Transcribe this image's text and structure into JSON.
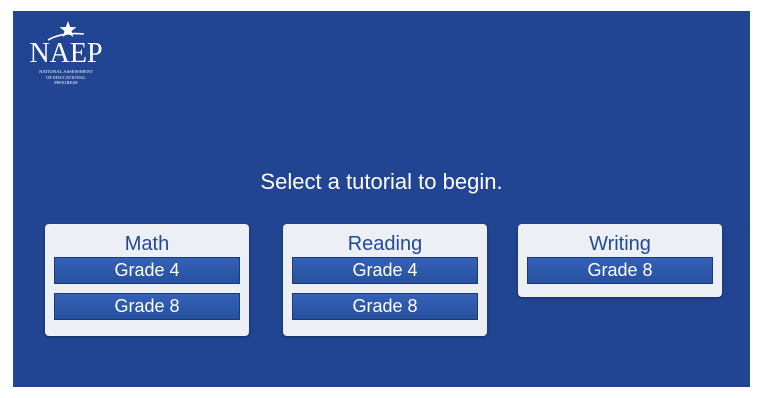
{
  "logo": {
    "wordmark": "NAEP",
    "subtitle_lines": [
      "NATIONAL ASSESSMENT",
      "OF EDUCATIONAL",
      "PROGRESS"
    ],
    "icon": "star-swoosh-icon"
  },
  "prompt": "Select a tutorial to begin.",
  "subjects": [
    {
      "title": "Math",
      "grades": [
        "Grade 4",
        "Grade 8"
      ]
    },
    {
      "title": "Reading",
      "grades": [
        "Grade 4",
        "Grade 8"
      ]
    },
    {
      "title": "Writing",
      "grades": [
        "Grade 8"
      ]
    }
  ],
  "colors": {
    "background": "#214592",
    "card": "#eceff3",
    "button": "#2d5aae",
    "title_text": "#23499a"
  }
}
